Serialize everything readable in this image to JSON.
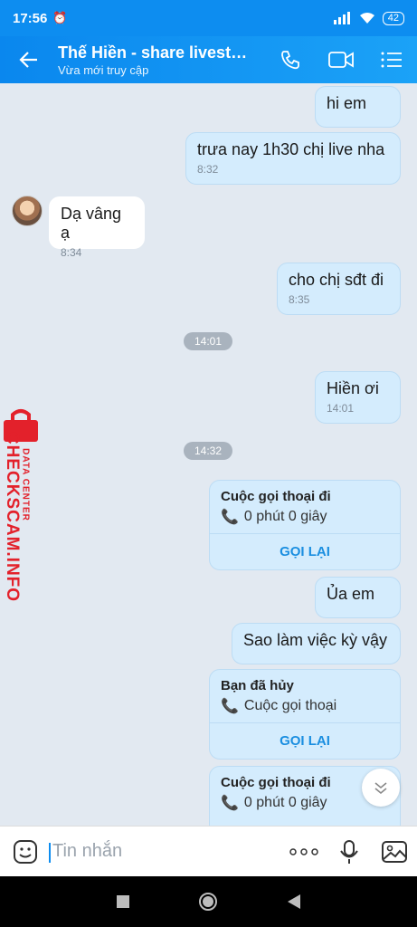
{
  "status": {
    "time": "17:56",
    "battery": "42"
  },
  "header": {
    "title": "Thế Hiền - share livestr...",
    "subtitle": "Vừa mới truy cập"
  },
  "messages": [
    {
      "text": "hi em"
    },
    {
      "text": "trưa nay 1h30 chị live nha",
      "time": "8:32"
    },
    {
      "text": "Dạ vâng ạ",
      "time": "8:34"
    },
    {
      "text": "cho chị sđt đi",
      "time": "8:35"
    },
    {
      "text": "Hiền ơi",
      "time": "14:01"
    },
    {
      "text": "Ủa em"
    },
    {
      "text": "Sao làm việc kỳ vậy"
    }
  ],
  "time_chips": [
    "14:01",
    "14:32"
  ],
  "calls": [
    {
      "title": "Cuộc gọi thoại đi",
      "sub": "0 phút 0 giây",
      "action": "GỌI LẠI"
    },
    {
      "title": "Bạn đã hủy",
      "sub": "Cuộc gọi thoại",
      "action": "GỌI LẠI"
    },
    {
      "title": "Cuộc gọi thoại đi",
      "sub": "0 phút 0 giây"
    }
  ],
  "watermark": {
    "brand": "CHECKSCAM.INFO",
    "sub": "DATA CENTER"
  },
  "composer": {
    "placeholder": "Tin nhắn"
  }
}
